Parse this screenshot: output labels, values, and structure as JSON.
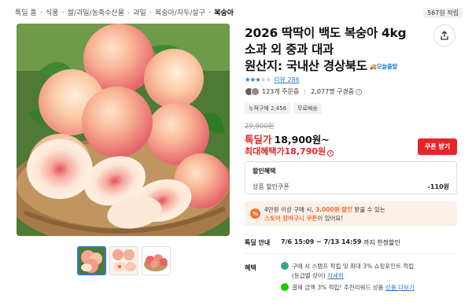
{
  "breadcrumb": [
    "특딜 홈",
    "식품",
    "쌀/과일/농축수산물",
    "과일",
    "복숭아/자두/살구",
    "복숭아"
  ],
  "top_badge": "567원 적립",
  "product": {
    "title_lines": [
      "2026 딱딱이 백도 복숭아 4kg",
      "소과 외 중과 대과",
      "원산지: 국내산 경상북도"
    ],
    "delivery_badge": "오늘출발",
    "rating": 3,
    "review_label": "리뷰 286",
    "orders": "123개 주문중",
    "watchers": "2,077명 구경중"
  },
  "chips": [
    "누적구매 2,456",
    "무료배송"
  ],
  "price": {
    "original": "29,900원",
    "special_label": "톡딜가",
    "special_value": "18,900원~",
    "max_label": "최대혜택가",
    "max_value": "18,790원",
    "coupon_button": "쿠폰 받기"
  },
  "discount": {
    "title": "할인혜택",
    "row_label": "상품 할인쿠폰",
    "row_value": "-110원"
  },
  "promo": {
    "icon": "%",
    "line1_a": "4만원 이상 구매 시, ",
    "line1_b": "3,000원 할인",
    "line1_c": " 받을 수 있는",
    "line2_a": "스토어 장바구니 쿠폰",
    "line2_b": "이 있어요!"
  },
  "special_info": {
    "label": "톡딜 안내",
    "time": "7/6 15:09 ~ 7/13 14:59",
    "suffix": "까지 한정할인"
  },
  "benefits": {
    "label": "혜택",
    "b1_line1": "구매 시 스탬프 적립 및 최대 3% 쇼핑포인트 적립",
    "b1_line2": "(등급별 상이) ",
    "b1_link": "자세히",
    "b2_text": "결제 금액 3% 적립! 추천리워드 상품 ",
    "b2_link": "상품 더보기"
  },
  "colors": {
    "accent": "#e52528",
    "link": "#2a7ad3",
    "promo": "#f07030"
  },
  "icons": [
    "share-icon",
    "chevron-right-icon",
    "info-icon",
    "kakaopay-icon",
    "naver-icon"
  ]
}
